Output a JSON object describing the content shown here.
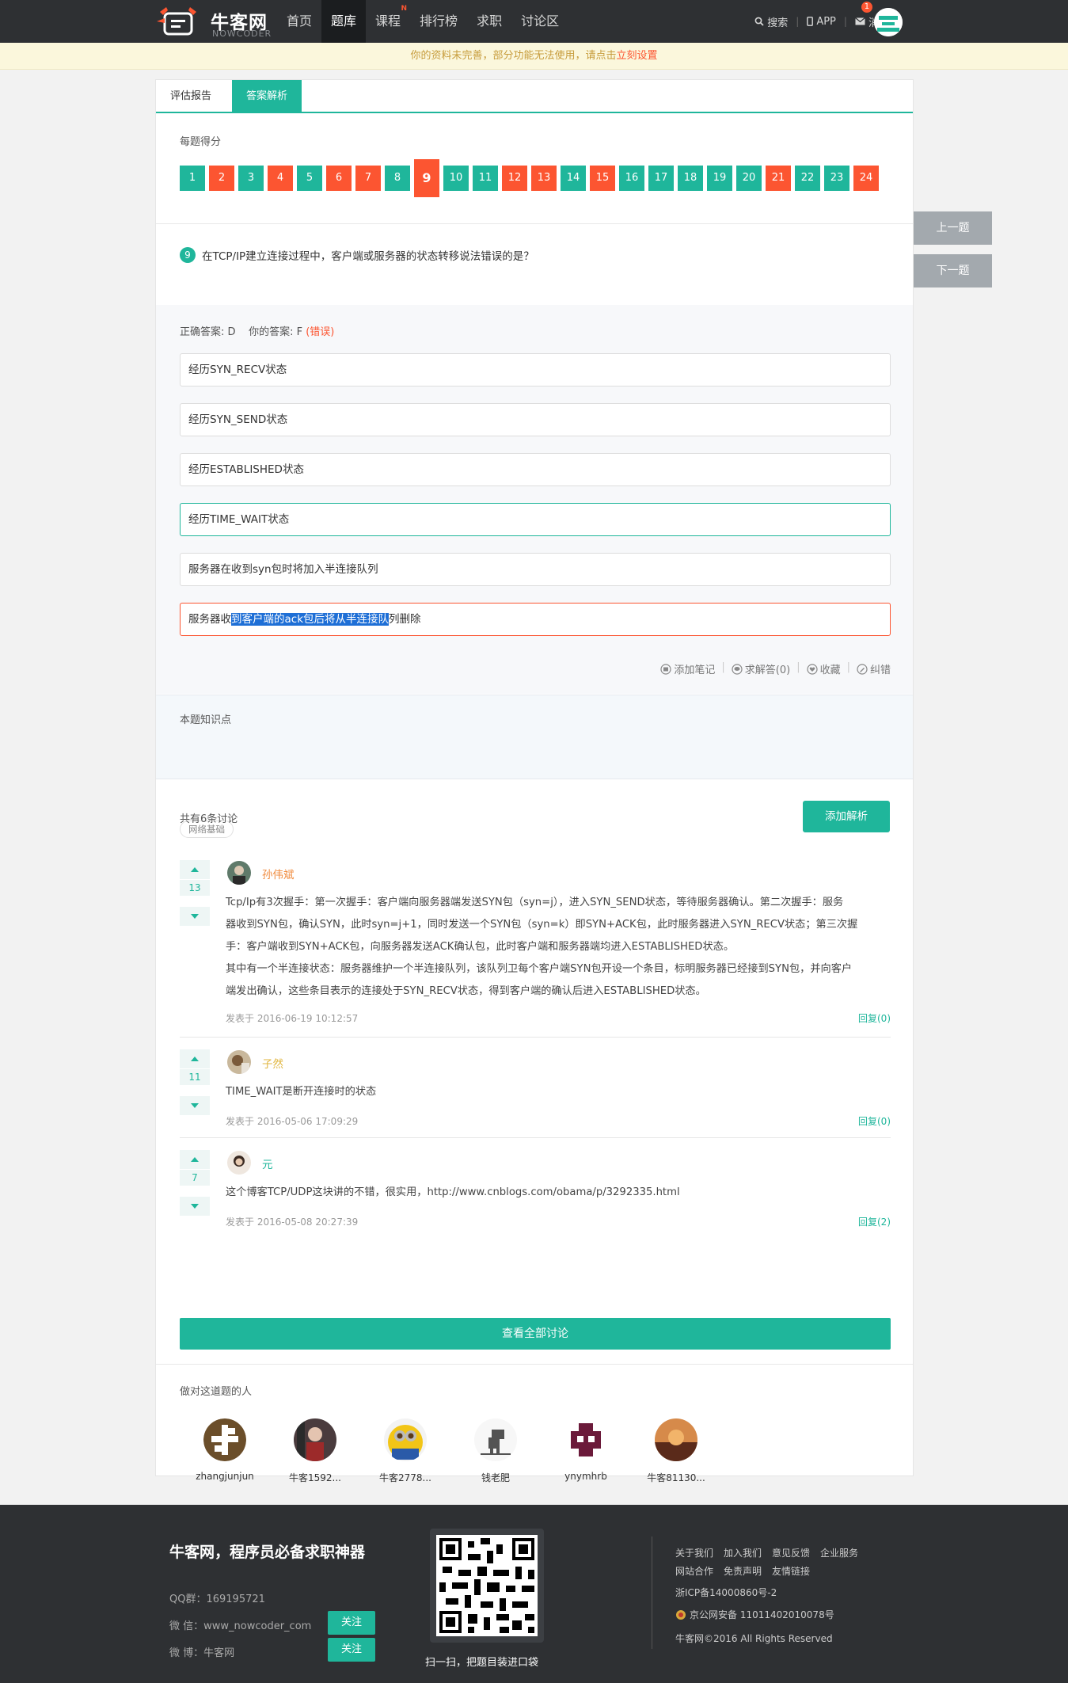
{
  "header": {
    "logo_cn": "牛客网",
    "logo_en": "NOWCODER",
    "nav": [
      {
        "label": "首页"
      },
      {
        "label": "题库"
      },
      {
        "label": "课程",
        "badge": "N"
      },
      {
        "label": "排行榜"
      },
      {
        "label": "求职"
      },
      {
        "label": "讨论区"
      }
    ],
    "search": "搜索",
    "app": "APP",
    "messages": "消息",
    "message_count": "1"
  },
  "notice": {
    "text": "你的资料未完善，部分功能无法使用，请点击",
    "link": "立刻设置"
  },
  "tabs": [
    "评估报告",
    "答案解析"
  ],
  "score_label": "每题得分",
  "questions": [
    {
      "n": "1",
      "s": "g"
    },
    {
      "n": "2",
      "s": "r"
    },
    {
      "n": "3",
      "s": "g"
    },
    {
      "n": "4",
      "s": "r"
    },
    {
      "n": "5",
      "s": "g"
    },
    {
      "n": "6",
      "s": "r"
    },
    {
      "n": "7",
      "s": "r"
    },
    {
      "n": "8",
      "s": "g"
    },
    {
      "n": "9",
      "s": "r cur"
    },
    {
      "n": "10",
      "s": "g"
    },
    {
      "n": "11",
      "s": "g"
    },
    {
      "n": "12",
      "s": "r"
    },
    {
      "n": "13",
      "s": "r"
    },
    {
      "n": "14",
      "s": "g"
    },
    {
      "n": "15",
      "s": "r"
    },
    {
      "n": "16",
      "s": "g"
    },
    {
      "n": "17",
      "s": "g"
    },
    {
      "n": "18",
      "s": "g"
    },
    {
      "n": "19",
      "s": "g"
    },
    {
      "n": "20",
      "s": "g"
    },
    {
      "n": "21",
      "s": "r"
    },
    {
      "n": "22",
      "s": "g"
    },
    {
      "n": "23",
      "s": "g"
    },
    {
      "n": "24",
      "s": "r"
    }
  ],
  "question": {
    "number": "9",
    "text": "在TCP/IP建立连接过程中，客户端或服务器的状态转移说法错误的是？"
  },
  "answer": {
    "correct": "正确答案: D",
    "yours": "你的答案: F",
    "verdict": "(错误)"
  },
  "options": {
    "o1": "经历SYN_RECV状态",
    "o2": "经历SYN_SEND状态",
    "o3": "经历ESTABLISHED状态",
    "o4": "经历TIME_WAIT状态",
    "o5": "服务器在收到syn包时将加入半连接队列",
    "o6a": "服务器收",
    "o6b": "到客户端的ack包后将从半连接队",
    "o6c": "列删除"
  },
  "actions": {
    "note": "添加笔记",
    "ask": "求解答(0)",
    "fav": "收藏",
    "fix": "纠错"
  },
  "knowledge": {
    "label": "本题知识点",
    "tag": "网络基础"
  },
  "discussion": {
    "count_text": "共有6条讨论",
    "add_button": "添加解析",
    "view_all": "查看全部讨论"
  },
  "comments": {
    "c1": {
      "votes": "13",
      "name": "孙伟斌",
      "l1": "Tcp/Ip有3次握手：第一次握手：客户端向服务器端发送SYN包（syn=j），进入SYN_SEND状态，等待服务器确认。第二次握手：服务",
      "l2": "器收到SYN包，确认SYN，此时syn=j+1，同时发送一个SYN包（syn=k）即SYN+ACK包，此时服务器进入SYN_RECV状态；第三次握",
      "l3": "手：客户端收到SYN+ACK包，向服务器发送ACK确认包，此时客户端和服务器端均进入ESTABLISHED状态。",
      "l4": "其中有一个半连接状态：服务器维护一个半连接队列，该队列卫每个客户端SYN包开设一个条目，标明服务器已经接到SYN包，并向客户",
      "l5": "端发出确认，这些条目表示的连接处于SYN_RECV状态，得到客户端的确认后进入ESTABLISHED状态。",
      "time": "发表于 2016-06-19 10:12:57",
      "reply": "回复(0)"
    },
    "c2": {
      "votes": "11",
      "name": "子然",
      "l1": "TIME_WAIT是断开连接时的状态",
      "time": "发表于 2016-05-06 17:09:29",
      "reply": "回复(0)"
    },
    "c3": {
      "votes": "7",
      "name": "元",
      "l1": "这个博客TCP/UDP这块讲的不错，很实用，http://www.cnblogs.com/obama/p/3292335.html",
      "time": "发表于 2016-05-08 20:27:39",
      "reply": "回复(2)"
    }
  },
  "solvers": {
    "label": "做对这道题的人",
    "u1": "zhangjunjun",
    "u2": "牛客1592...",
    "u3": "牛客2778...",
    "u4": "钱老肥",
    "u5": "ynymhrb",
    "u6": "牛客81130..."
  },
  "side": {
    "prev": "上一题",
    "next": "下一题"
  },
  "footer": {
    "slogan": "牛客网，程序员必备求职神器",
    "qq": "QQ群：169195721",
    "wechat": "微 信：www_nowcoder_com",
    "weibo": "微 博：牛客网",
    "follow": "关注",
    "qr_caption": "扫一扫，把题目装进口袋",
    "links1": [
      "关于我们",
      "加入我们",
      "意见反馈",
      "企业服务"
    ],
    "links2": [
      "网站合作",
      "免责声明",
      "友情链接"
    ],
    "icp": "浙ICP备14000860号-2",
    "police": "京公网安备 11011402010078号",
    "copyright": "牛客网©2016 All Rights Reserved"
  },
  "colors": {
    "brand": "#1fb69b",
    "error": "#fc5531",
    "header": "#2e3033"
  }
}
